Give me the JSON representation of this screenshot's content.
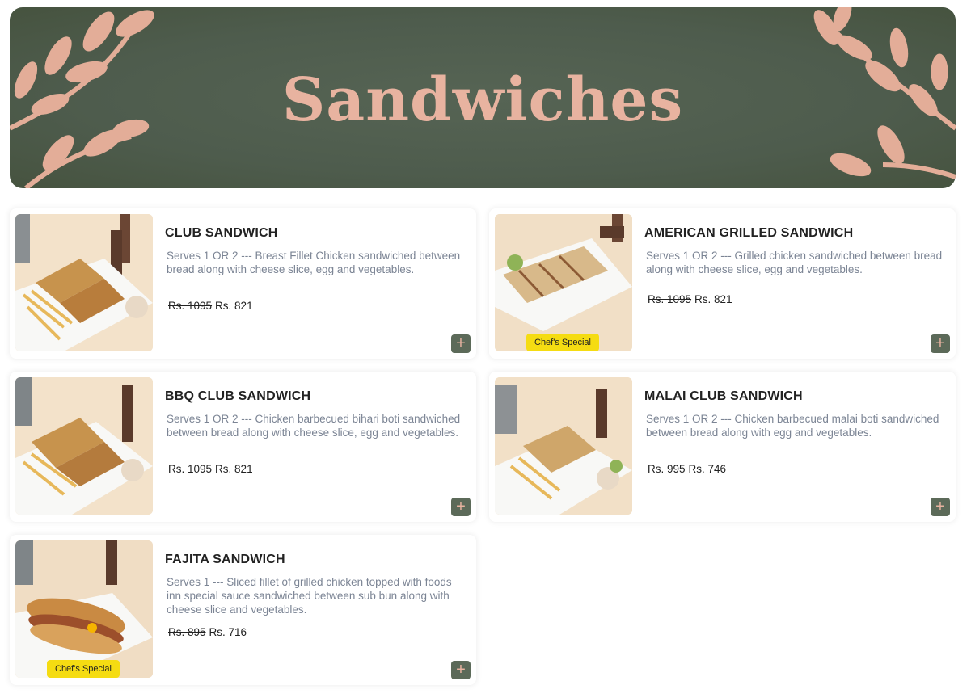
{
  "banner": {
    "title": "Sandwiches"
  },
  "items": [
    {
      "name": "CLUB SANDWICH",
      "description": "Serves 1 OR 2 --- Breast Fillet Chicken sandwiched between bread along with cheese slice, egg and vegetables.",
      "old_price": "Rs. 1095",
      "price": "Rs. 821",
      "badge": ""
    },
    {
      "name": "AMERICAN GRILLED SANDWICH",
      "description": "Serves 1 OR 2 --- Grilled chicken sandwiched between bread along with cheese slice, egg and vegetables.",
      "old_price": "Rs. 1095",
      "price": "Rs. 821",
      "badge": "Chef's Special"
    },
    {
      "name": "BBQ CLUB SANDWICH",
      "description": "Serves 1 OR 2 --- Chicken barbecued bihari boti sandwiched between bread along with cheese slice, egg and vegetables.",
      "old_price": "Rs. 1095",
      "price": "Rs. 821",
      "badge": ""
    },
    {
      "name": "MALAI CLUB SANDWICH",
      "description": "Serves 1 OR 2 --- Chicken barbecued malai boti sandwiched between bread along with egg and vegetables.",
      "old_price": "Rs. 995",
      "price": "Rs. 746",
      "badge": ""
    },
    {
      "name": "FAJITA SANDWICH",
      "description": "Serves 1 --- Sliced fillet of grilled chicken topped with foods inn special sauce sandwiched between sub bun along with cheese slice and vegetables.",
      "old_price": "Rs. 895",
      "price": "Rs. 716",
      "badge": "Chef's Special"
    }
  ],
  "add_button_icon": "plus-icon",
  "colors": {
    "banner_bg": "#4e5c4d",
    "banner_text": "#e8b3a0",
    "add_button_bg": "#5c6a59",
    "badge_bg": "#f5dc12",
    "description_text": "#7b8494"
  }
}
